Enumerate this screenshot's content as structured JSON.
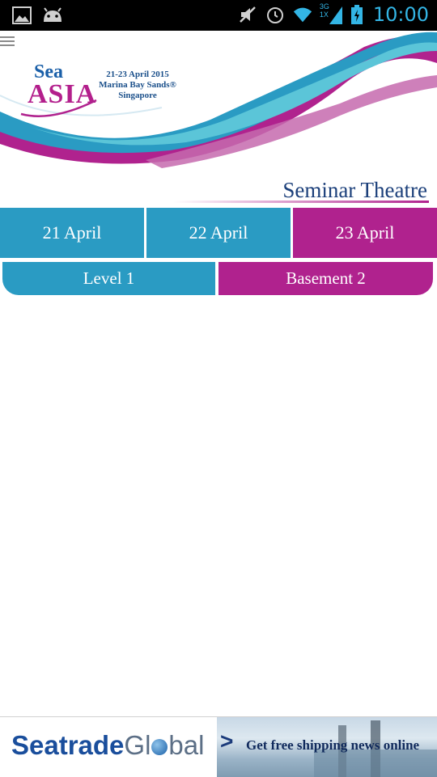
{
  "status_bar": {
    "time": "10:00",
    "icons": [
      "image-icon",
      "android-icon",
      "mute-icon",
      "alarm-icon",
      "wifi-icon",
      "signal-icon",
      "battery-icon"
    ],
    "network_type": "3G",
    "network_sub": "1X"
  },
  "header": {
    "logo_top": "Sea",
    "logo_main": "ASIA",
    "event_dates": "21-23 April 2015",
    "event_venue": "Marina Bay Sands®",
    "event_city": "Singapore"
  },
  "page": {
    "title": "Seminar Theatre"
  },
  "date_tabs": [
    {
      "label": "21 April",
      "active": false
    },
    {
      "label": "22 April",
      "active": false
    },
    {
      "label": "23 April",
      "active": true
    }
  ],
  "level_tabs": [
    {
      "label": "Level 1",
      "active": false
    },
    {
      "label": "Basement 2",
      "active": true
    }
  ],
  "ad": {
    "brand_part1": "Seatrade",
    "brand_part2": "Gl",
    "brand_part3": "bal",
    "arrow": ">",
    "tagline": "Get free shipping news online"
  },
  "colors": {
    "accent_blue": "#2a9bc3",
    "accent_magenta": "#b0228e",
    "title_navy": "#1b3f7a"
  }
}
